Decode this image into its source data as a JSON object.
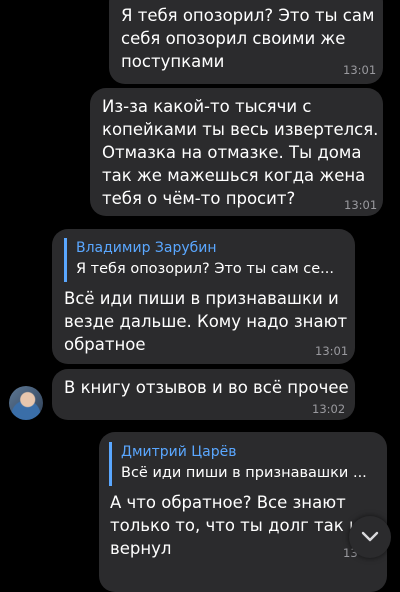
{
  "messages": [
    {
      "text": "Я тебя опозорил? Это ты сам\nсебя опозорил своими же\nпоступками",
      "time": "13:01"
    },
    {
      "text": "Из-за какой-то тысячи с\nкопейками ты весь извертелся.\nОтмазка на отмазке. Ты дома\nтак же мажешься когда жена\nтебя о чём-то просит?",
      "time": "13:01"
    },
    {
      "reply_name": "Владимир Зарубин",
      "reply_snippet": "Я тебя опозорил? Это ты сам се...",
      "text": "Всё иди пиши в признавашки и\nвезде дальше. Кому надо знают\nобратное",
      "time": "13:01"
    },
    {
      "text": "В книгу отзывов и во всё прочее",
      "time": "13:02"
    },
    {
      "reply_name": "Дмитрий Царёв",
      "reply_snippet": "Всё иди пиши в признавашки ...",
      "text": "А что обратное? Все знают\nтолько то, что ты долг так и н\nвернул",
      "time": "13"
    }
  ],
  "icons": {
    "scroll_down": "chevron-down-icon",
    "avatar": "user-avatar"
  },
  "colors": {
    "background": "#000000",
    "bubble": "#2b2b2d",
    "accent": "#5aa7ff",
    "time": "#9a9a9f"
  }
}
